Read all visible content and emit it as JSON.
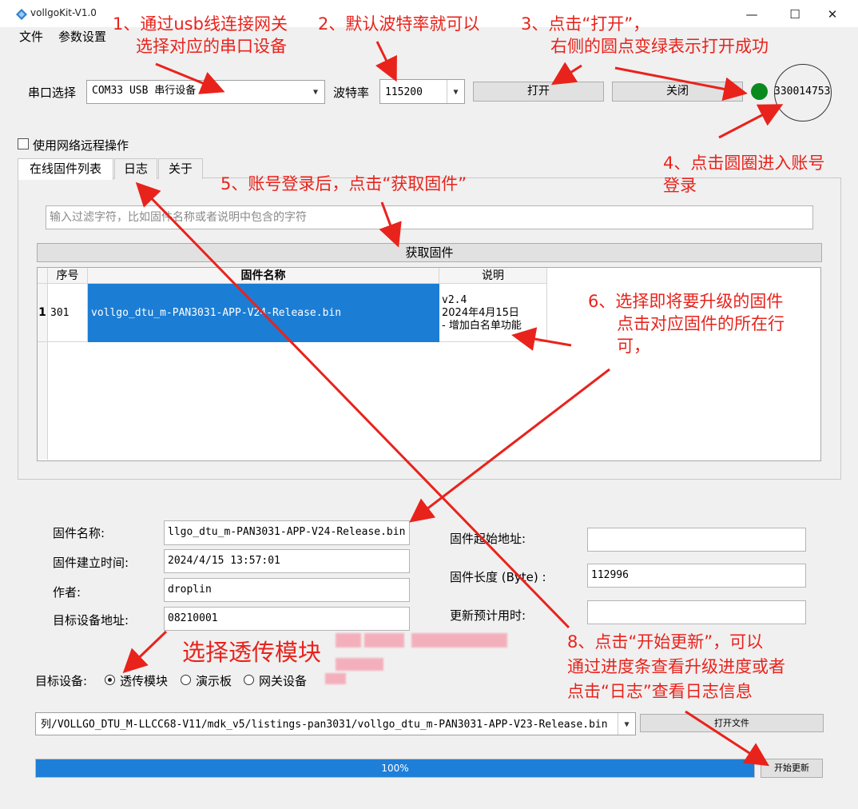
{
  "window": {
    "title": "vollgoKit-V1.0",
    "controls": [
      "—",
      "☐",
      "✕"
    ]
  },
  "menu": [
    "文件",
    "参数设置"
  ],
  "serial": {
    "port_label": "串口选择",
    "port_value": "COM33 USB 串行设备",
    "baud_label": "波特率",
    "baud_value": "115200",
    "open_label": "打开",
    "close_label": "关闭",
    "status_color": "#0a8a1e",
    "account_id": "330014753"
  },
  "remote_checkbox_label": "使用网络远程操作",
  "tabs": [
    "在线固件列表",
    "日志",
    "关于"
  ],
  "filter": {
    "placeholder": "输入过滤字符，比如固件名称或者说明中包含的字符"
  },
  "fetch_button": "获取固件",
  "table": {
    "headers": [
      "序号",
      "固件名称",
      "说明"
    ],
    "rows": [
      {
        "row_num": "1",
        "index": "301",
        "name": "vollgo_dtu_m-PAN3031-APP-V24-Release.bin",
        "desc": [
          "v2.4",
          "2024年4月15日",
          "- 增加白名单功能"
        ]
      }
    ]
  },
  "firmware": {
    "name_label": "固件名称:",
    "name_value": "llgo_dtu_m-PAN3031-APP-V24-Release.bin",
    "build_time_label": "固件建立时间:",
    "build_time_value": "2024/4/15 13:57:01",
    "author_label": "作者:",
    "author_value": "droplin",
    "target_addr_label": "目标设备地址:",
    "target_addr_value": "08210001",
    "start_addr_label": "固件起始地址:",
    "start_addr_value": "",
    "length_label": "固件长度 (Byte) :",
    "length_value": "112996",
    "eta_label": "更新预计用时:",
    "eta_value": ""
  },
  "target_device": {
    "label": "目标设备:",
    "options": [
      "透传模块",
      "演示板",
      "网关设备"
    ],
    "selected": "透传模块"
  },
  "file_path": "列/VOLLGO_DTU_M-LLCC68-V11/mdk_v5/listings-pan3031/vollgo_dtu_m-PAN3031-APP-V23-Release.bin",
  "open_file_button": "打开文件",
  "progress": {
    "value": 1.0,
    "text": "100%",
    "color": "#1e7fd8"
  },
  "start_update_button": "开始更新",
  "annotations": {
    "a1": [
      "1、通过usb线连接网关",
      "选择对应的串口设备"
    ],
    "a2": [
      "2、默认波特率就可以"
    ],
    "a3": [
      "3、点击“打开”，",
      "右侧的圆点变绿表示打开成功"
    ],
    "a4": [
      "4、点击圆圈进入账号",
      "登录"
    ],
    "a5": [
      "5、账号登录后，点击“获取固件”"
    ],
    "a6": [
      "6、选择即将要升级的固件",
      "点击对应固件的所在行",
      "可，"
    ],
    "a7": [
      "选择透传模块"
    ],
    "a8": [
      "8、点击“开始更新”，可以",
      "通过进度条查看升级进度或者",
      "点击“日志”查看日志信息"
    ]
  }
}
